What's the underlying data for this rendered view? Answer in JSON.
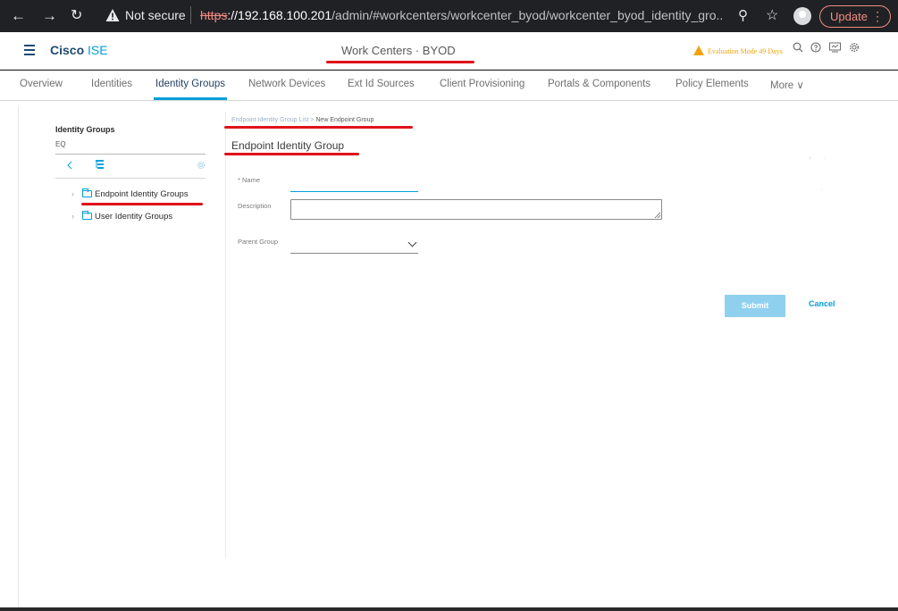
{
  "browser": {
    "back_icon": "arrow-left-icon",
    "forward_icon": "arrow-right-icon",
    "reload_icon": "reload-icon",
    "security_text": "Not secure",
    "url_scheme": "https",
    "url_host": "://192.168.100.201",
    "url_path": "/admin/#workcenters/workcenter_byod/workcenter_byod_identity_gro...",
    "update_label": "Update",
    "update_menu": "⋮"
  },
  "header": {
    "brand_bold": "Cisco",
    "brand_light": " ISE",
    "center_title": "Work Centers · BYOD",
    "eval_text": "Evaluation Mode 49 Days",
    "icons": [
      "search-icon",
      "help-icon",
      "notifications-icon",
      "gear-icon"
    ]
  },
  "tabs": [
    {
      "label": "Overview"
    },
    {
      "label": "Identities"
    },
    {
      "label": "Identity Groups",
      "active": true
    },
    {
      "label": "Network Devices"
    },
    {
      "label": "Ext Id Sources"
    },
    {
      "label": "Client Provisioning"
    },
    {
      "label": "Portals & Components"
    },
    {
      "label": "Policy Elements"
    },
    {
      "label": "More ∨"
    }
  ],
  "left_panel": {
    "title": "Identity Groups",
    "search_placeholder": "EQ",
    "tree": [
      {
        "label": "Endpoint Identity Groups"
      },
      {
        "label": "User Identity Groups"
      }
    ]
  },
  "form": {
    "breadcrumb_link": "Endpoint Identity Group List",
    "breadcrumb_sep": " > ",
    "breadcrumb_current": "New Endpoint Group",
    "title": "Endpoint Identity Group",
    "name_label": "* Name",
    "name_value": "",
    "description_label": "Description",
    "description_value": "",
    "parent_label": "Parent Group",
    "parent_value": "",
    "submit_label": "Submit",
    "cancel_label": "Cancel"
  },
  "colors": {
    "accent": "#049fd9",
    "warning": "#f0a30a",
    "annotation": "#e0121a"
  }
}
